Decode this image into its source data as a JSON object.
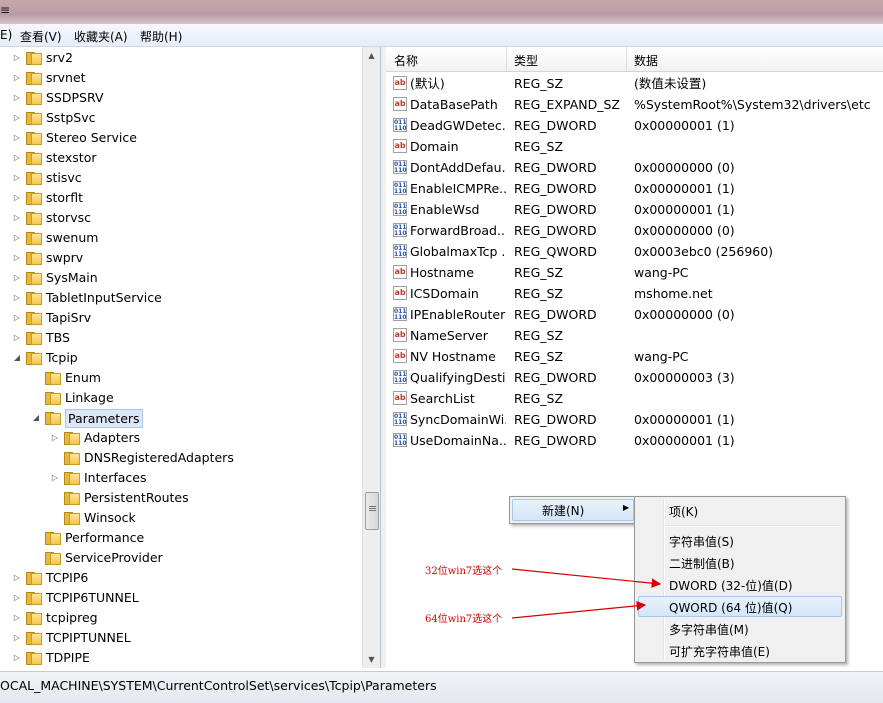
{
  "window": {
    "title_fragment": "≡"
  },
  "menubar": {
    "items": [
      "E)",
      "查看(V)",
      "收藏夹(A)",
      "帮助(H)"
    ]
  },
  "tree": {
    "items": [
      {
        "label": "srv2",
        "depth": 0,
        "arrow": "collapsed"
      },
      {
        "label": "srvnet",
        "depth": 0,
        "arrow": "collapsed"
      },
      {
        "label": "SSDPSRV",
        "depth": 0,
        "arrow": "collapsed"
      },
      {
        "label": "SstpSvc",
        "depth": 0,
        "arrow": "collapsed"
      },
      {
        "label": "Stereo Service",
        "depth": 0,
        "arrow": "collapsed"
      },
      {
        "label": "stexstor",
        "depth": 0,
        "arrow": "collapsed"
      },
      {
        "label": "stisvc",
        "depth": 0,
        "arrow": "collapsed"
      },
      {
        "label": "storflt",
        "depth": 0,
        "arrow": "collapsed"
      },
      {
        "label": "storvsc",
        "depth": 0,
        "arrow": "collapsed"
      },
      {
        "label": "swenum",
        "depth": 0,
        "arrow": "collapsed"
      },
      {
        "label": "swprv",
        "depth": 0,
        "arrow": "collapsed"
      },
      {
        "label": "SysMain",
        "depth": 0,
        "arrow": "collapsed"
      },
      {
        "label": "TabletInputService",
        "depth": 0,
        "arrow": "collapsed"
      },
      {
        "label": "TapiSrv",
        "depth": 0,
        "arrow": "collapsed"
      },
      {
        "label": "TBS",
        "depth": 0,
        "arrow": "collapsed"
      },
      {
        "label": "Tcpip",
        "depth": 0,
        "arrow": "expanded"
      },
      {
        "label": "Enum",
        "depth": 1,
        "arrow": "none"
      },
      {
        "label": "Linkage",
        "depth": 1,
        "arrow": "none"
      },
      {
        "label": "Parameters",
        "depth": 1,
        "arrow": "expanded",
        "selected": true
      },
      {
        "label": "Adapters",
        "depth": 2,
        "arrow": "collapsed"
      },
      {
        "label": "DNSRegisteredAdapters",
        "depth": 2,
        "arrow": "none"
      },
      {
        "label": "Interfaces",
        "depth": 2,
        "arrow": "collapsed"
      },
      {
        "label": "PersistentRoutes",
        "depth": 2,
        "arrow": "none"
      },
      {
        "label": "Winsock",
        "depth": 2,
        "arrow": "none"
      },
      {
        "label": "Performance",
        "depth": 1,
        "arrow": "none"
      },
      {
        "label": "ServiceProvider",
        "depth": 1,
        "arrow": "none"
      },
      {
        "label": "TCPIP6",
        "depth": 0,
        "arrow": "collapsed"
      },
      {
        "label": "TCPIP6TUNNEL",
        "depth": 0,
        "arrow": "collapsed"
      },
      {
        "label": "tcpipreg",
        "depth": 0,
        "arrow": "collapsed"
      },
      {
        "label": "TCPIPTUNNEL",
        "depth": 0,
        "arrow": "collapsed"
      },
      {
        "label": "TDPIPE",
        "depth": 0,
        "arrow": "collapsed"
      }
    ]
  },
  "list": {
    "columns": [
      "名称",
      "类型",
      "数据"
    ],
    "rows": [
      {
        "icon": "string",
        "name": "(默认)",
        "type": "REG_SZ",
        "data": "(数值未设置)"
      },
      {
        "icon": "string",
        "name": "DataBasePath",
        "type": "REG_EXPAND_SZ",
        "data": "%SystemRoot%\\System32\\drivers\\etc"
      },
      {
        "icon": "binary",
        "name": "DeadGWDetec...",
        "type": "REG_DWORD",
        "data": "0x00000001 (1)"
      },
      {
        "icon": "string",
        "name": "Domain",
        "type": "REG_SZ",
        "data": ""
      },
      {
        "icon": "binary",
        "name": "DontAddDefau...",
        "type": "REG_DWORD",
        "data": "0x00000000 (0)"
      },
      {
        "icon": "binary",
        "name": "EnableICMPRe...",
        "type": "REG_DWORD",
        "data": "0x00000001 (1)"
      },
      {
        "icon": "binary",
        "name": "EnableWsd",
        "type": "REG_DWORD",
        "data": "0x00000001 (1)"
      },
      {
        "icon": "binary",
        "name": "ForwardBroad...",
        "type": "REG_DWORD",
        "data": "0x00000000 (0)"
      },
      {
        "icon": "binary",
        "name": "GlobalmaxTcp ...",
        "type": "REG_QWORD",
        "data": "0x0003ebc0 (256960)"
      },
      {
        "icon": "string",
        "name": "Hostname",
        "type": "REG_SZ",
        "data": "wang-PC"
      },
      {
        "icon": "string",
        "name": "ICSDomain",
        "type": "REG_SZ",
        "data": "mshome.net"
      },
      {
        "icon": "binary",
        "name": "IPEnableRouter",
        "type": "REG_DWORD",
        "data": "0x00000000 (0)"
      },
      {
        "icon": "string",
        "name": "NameServer",
        "type": "REG_SZ",
        "data": ""
      },
      {
        "icon": "string",
        "name": "NV Hostname",
        "type": "REG_SZ",
        "data": "wang-PC"
      },
      {
        "icon": "binary",
        "name": "QualifyingDesti...",
        "type": "REG_DWORD",
        "data": "0x00000003 (3)"
      },
      {
        "icon": "string",
        "name": "SearchList",
        "type": "REG_SZ",
        "data": ""
      },
      {
        "icon": "binary",
        "name": "SyncDomainWi...",
        "type": "REG_DWORD",
        "data": "0x00000001 (1)"
      },
      {
        "icon": "binary",
        "name": "UseDomainNa...",
        "type": "REG_DWORD",
        "data": "0x00000001 (1)"
      }
    ]
  },
  "context_menu": {
    "new_label": "新建(N)",
    "submenu": {
      "key": "项(K)",
      "string": "字符串值(S)",
      "binary": "二进制值(B)",
      "dword": "DWORD (32-位)值(D)",
      "qword": "QWORD (64 位)值(Q)",
      "multi": "多字符串值(M)",
      "expand": "可扩充字符串值(E)"
    }
  },
  "annotations": {
    "a32": "32位win7选这个",
    "a64": "64位win7选这个"
  },
  "statusbar": {
    "path": "OCAL_MACHINE\\SYSTEM\\CurrentControlSet\\services\\Tcpip\\Parameters"
  },
  "colors": {
    "annotation": "#d40000",
    "folder": "#f4c54a",
    "selection": "#dce8f6"
  }
}
